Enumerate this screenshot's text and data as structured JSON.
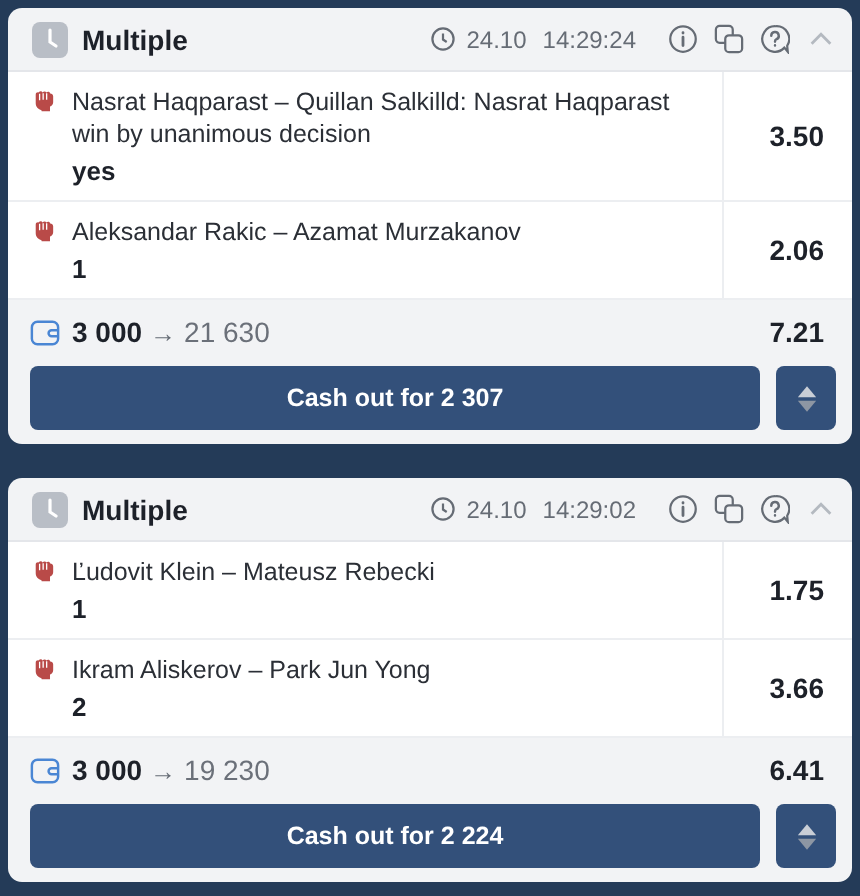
{
  "bets": [
    {
      "bet_type": "Multiple",
      "date": "24.10",
      "time": "14:29:24",
      "expanded": true,
      "selections": [
        {
          "event": "Nasrat Haqparast – Quillan Salkilld: Nasrat Haqparast win by unanimous decision",
          "outcome": "yes",
          "odds": "3.50"
        },
        {
          "event": "Aleksandar Rakic – Azamat Murzakanov",
          "outcome": "1",
          "odds": "2.06"
        }
      ],
      "stake": "3 000",
      "arrow": "→",
      "payout": "21 630",
      "total_odds": "7.21",
      "cashout": "Cash out for 2 307"
    },
    {
      "bet_type": "Multiple",
      "date": "24.10",
      "time": "14:29:02",
      "expanded": true,
      "selections": [
        {
          "event": "Ľudovit Klein – Mateusz Rebecki",
          "outcome": "1",
          "odds": "1.75"
        },
        {
          "event": "Ikram Aliskerov – Park Jun Yong",
          "outcome": "2",
          "odds": "3.66"
        }
      ],
      "stake": "3 000",
      "arrow": "→",
      "payout": "19 230",
      "total_odds": "6.41",
      "cashout": "Cash out for 2 224"
    }
  ]
}
